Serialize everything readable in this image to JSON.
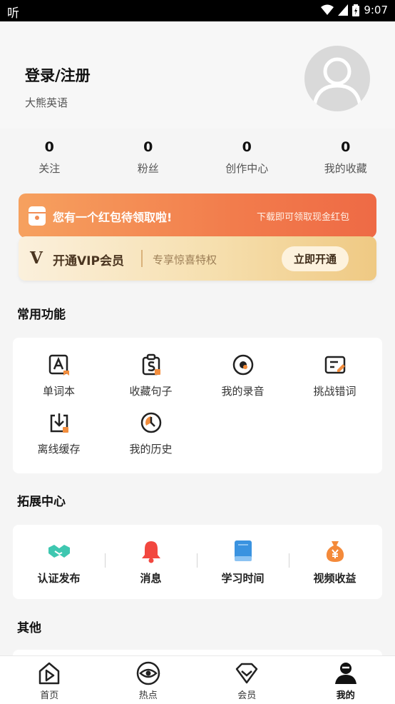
{
  "status_bar": {
    "left_icon": "听",
    "time": "9:07"
  },
  "profile": {
    "login_label": "登录/注册",
    "app_name": "大熊英语",
    "avatar_icon": "default-avatar-icon"
  },
  "stats": [
    {
      "value": "0",
      "label": "关注"
    },
    {
      "value": "0",
      "label": "粉丝"
    },
    {
      "value": "0",
      "label": "创作中心"
    },
    {
      "value": "0",
      "label": "我的收藏"
    }
  ],
  "red_packet": {
    "message": "您有一个红包待领取啦!",
    "hint": "下载即可领取现金红包"
  },
  "vip": {
    "logo": "V",
    "title": "开通VIP会员",
    "subtitle": "专享惊喜特权",
    "button": "立即开通"
  },
  "common": {
    "title": "常用功能",
    "items": [
      {
        "label": "单词本",
        "icon": "wordbook-icon"
      },
      {
        "label": "收藏句子",
        "icon": "saved-sentence-icon"
      },
      {
        "label": "我的录音",
        "icon": "recording-icon"
      },
      {
        "label": "挑战错词",
        "icon": "challenge-icon"
      },
      {
        "label": "离线缓存",
        "icon": "download-icon"
      },
      {
        "label": "我的历史",
        "icon": "history-icon"
      }
    ]
  },
  "extension": {
    "title": "拓展中心",
    "items": [
      {
        "label": "认证发布",
        "icon": "handshake-icon"
      },
      {
        "label": "消息",
        "icon": "bell-icon"
      },
      {
        "label": "学习时间",
        "icon": "book-icon"
      },
      {
        "label": "视频收益",
        "icon": "money-bag-icon"
      }
    ]
  },
  "other": {
    "title": "其他"
  },
  "bottom_nav": [
    {
      "label": "首页",
      "icon": "home-play-icon"
    },
    {
      "label": "热点",
      "icon": "eye-icon"
    },
    {
      "label": "会员",
      "icon": "vip-diamond-icon"
    },
    {
      "label": "我的",
      "icon": "profile-icon",
      "active": true
    }
  ],
  "colors": {
    "accent_orange": "#f27c4c",
    "vip_gold": "#efc983",
    "text_dark": "#222222"
  }
}
